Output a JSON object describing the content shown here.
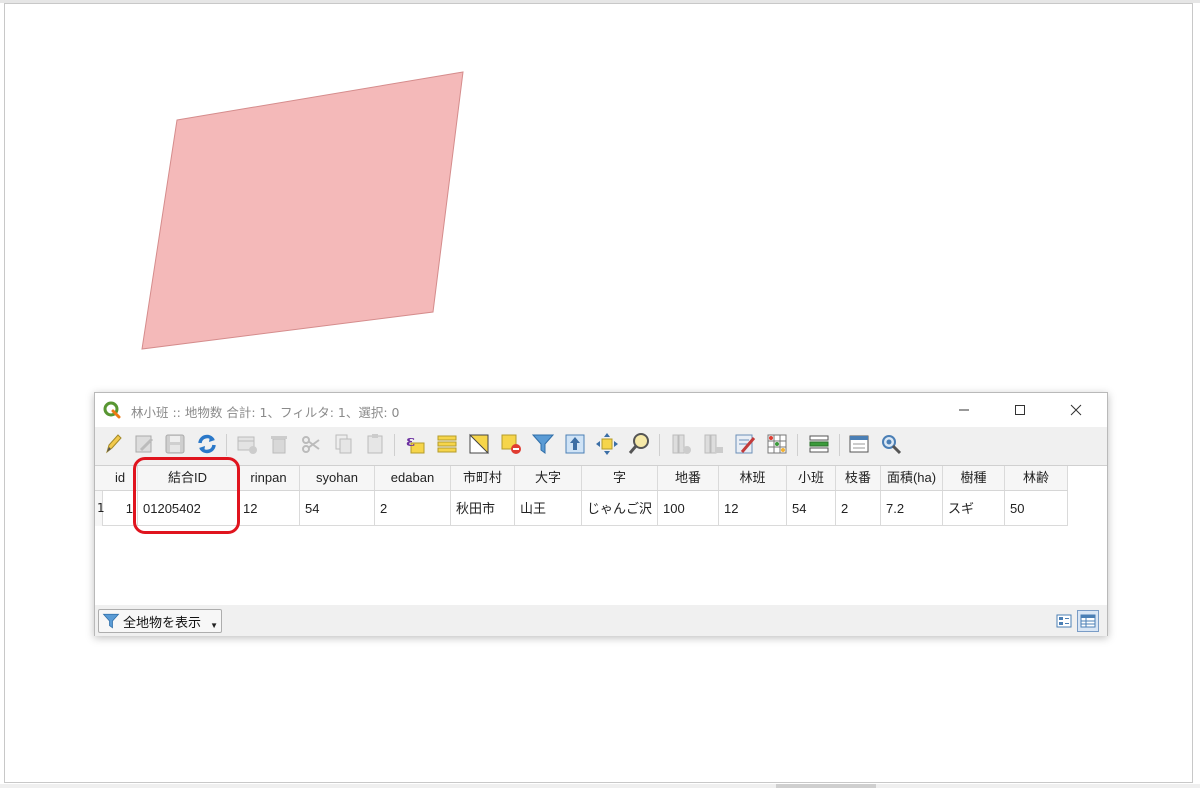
{
  "window": {
    "title": "林小班 :: 地物数 合計: 1、フィルタ: 1、選択: 0"
  },
  "titlebar_controls": {
    "minimize": "—",
    "maximize": "☐",
    "close": "✕"
  },
  "toolbar": {
    "icons": [
      "toggle-edit-icon",
      "multi-edit-icon",
      "save-edits-icon",
      "reload-icon",
      "add-feature-icon",
      "delete-feature-icon",
      "cut-icon",
      "copy-icon",
      "paste-icon",
      "select-by-expression-icon",
      "select-all-icon",
      "invert-selection-icon",
      "deselect-all-icon",
      "filter-select-icon",
      "move-selection-top-icon",
      "pan-to-selection-icon",
      "zoom-to-selection-icon",
      "new-field-icon",
      "delete-field-icon",
      "field-calculator-icon",
      "conditional-formatting-icon",
      "organize-columns-icon",
      "dock-table-icon",
      "actions-icon"
    ]
  },
  "table": {
    "columns": [
      "id",
      "結合ID",
      "rinpan",
      "syohan",
      "edaban",
      "市町村",
      "大字",
      "字",
      "地番",
      "林班",
      "小班",
      "枝番",
      "面積(ha)",
      "樹種",
      "林齢"
    ],
    "rows": [
      {
        "row_number": "1",
        "cells": [
          "1",
          "01205402",
          "12",
          "54",
          "2",
          "秋田市",
          "山王",
          "じゃんご沢",
          "100",
          "12",
          "54",
          "2",
          "7.2",
          "スギ",
          "50"
        ]
      }
    ]
  },
  "bottombar": {
    "filter_label": "全地物を表示"
  },
  "map": {
    "polygon_fill": "#f4b9b9",
    "polygon_stroke": "#d58c8c"
  },
  "colors": {
    "highlight": "#e0141e",
    "qgis_green": "#589632"
  }
}
